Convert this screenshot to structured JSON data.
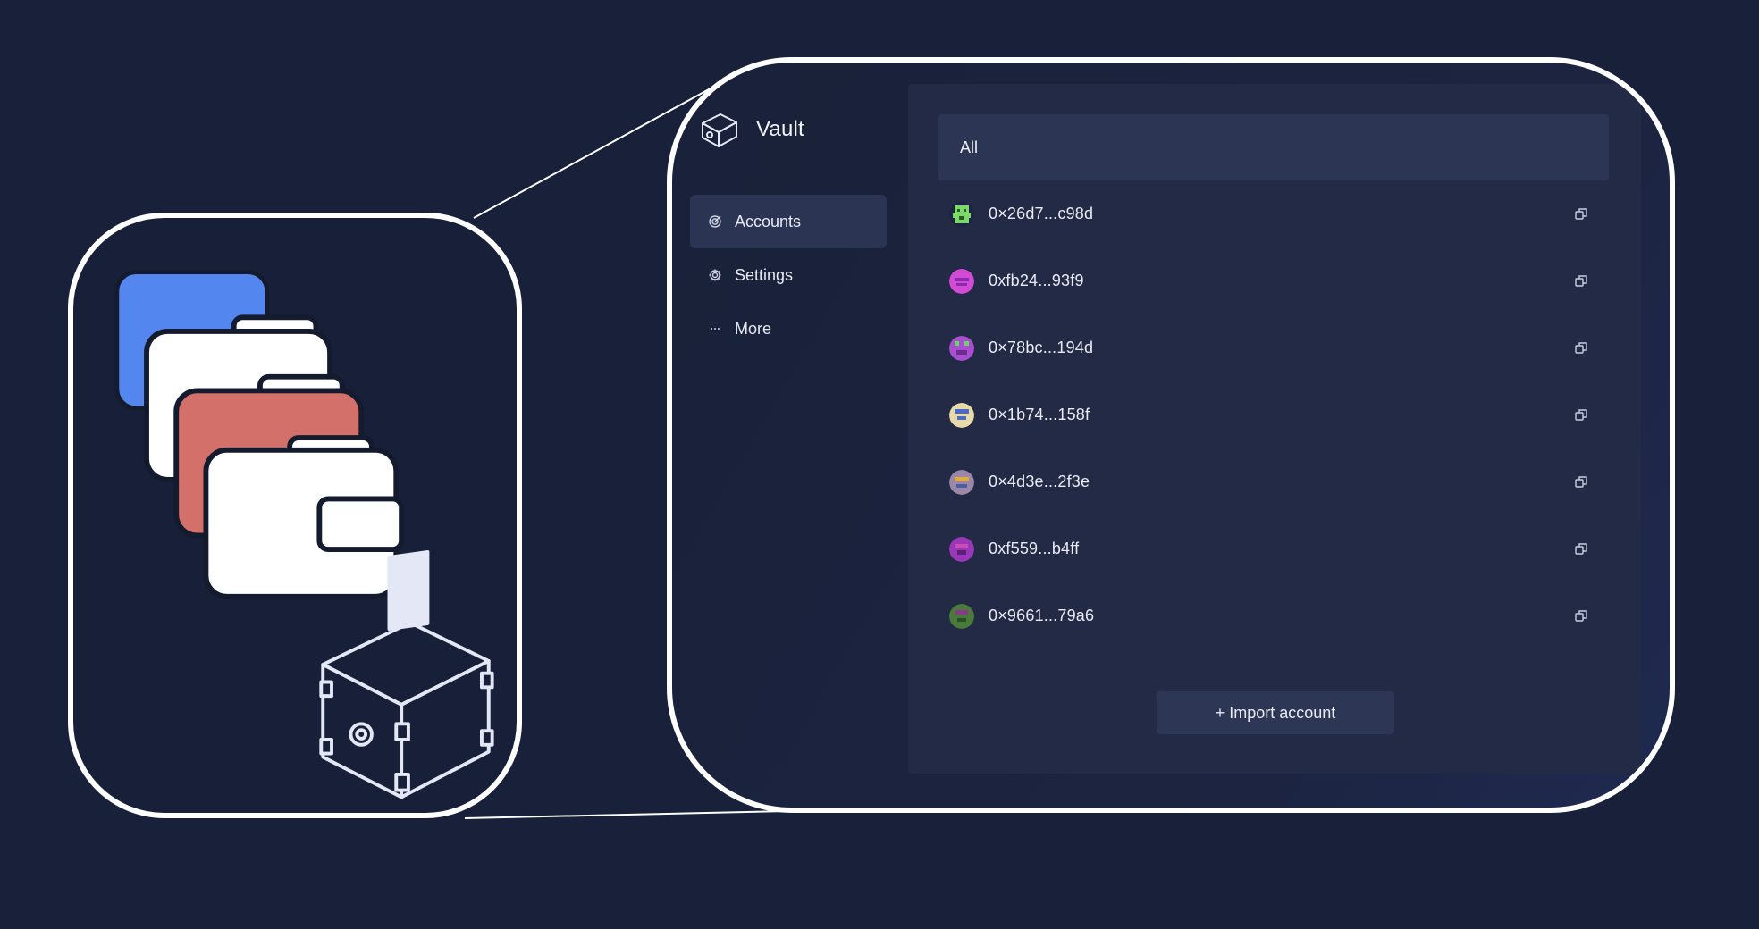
{
  "app": {
    "title": "Vault"
  },
  "sidebar": {
    "items": [
      {
        "label": "Accounts",
        "icon": "target-icon",
        "active": true
      },
      {
        "label": "Settings",
        "icon": "gear-icon",
        "active": false
      },
      {
        "label": "More",
        "icon": "more-icon",
        "active": false
      }
    ]
  },
  "filter": {
    "label": "All"
  },
  "accounts": [
    {
      "address": "0×26d7...c98d",
      "avatar_color": "#7bd86a"
    },
    {
      "address": "0xfb24...93f9",
      "avatar_color": "#d24ad6"
    },
    {
      "address": "0×78bc...194d",
      "avatar_color": "#a84fd0"
    },
    {
      "address": "0×1b74...158f",
      "avatar_color": "#e8d9a8"
    },
    {
      "address": "0×4d3e...2f3e",
      "avatar_color": "#9b88a8"
    },
    {
      "address": "0xf559...b4ff",
      "avatar_color": "#9a36b8"
    },
    {
      "address": "0×9661...79a6",
      "avatar_color": "#4a7a3a"
    }
  ],
  "import_button": {
    "label": "+ Import account"
  },
  "colors": {
    "background": "#18203a",
    "panel": "#232a46",
    "wallet_blue": "#5486f0",
    "wallet_red": "#d4706a"
  }
}
